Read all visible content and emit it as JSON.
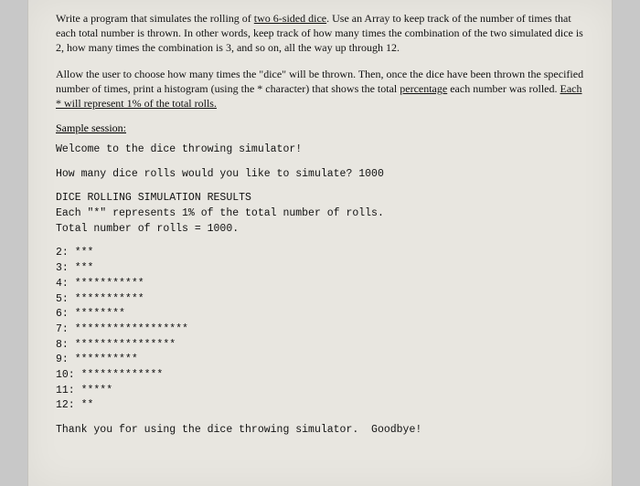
{
  "para1": {
    "pre": "Write a program that simulates the rolling of ",
    "u1": "two 6-sided dice",
    "post": ". Use an Array to keep track of the number of times that each total number is thrown. In other words, keep track of how many times the combination of the two simulated dice is 2, how many times the combination is 3, and so on, all the way up through 12."
  },
  "para2": {
    "pre": "Allow the user to choose how many times the \"dice\" will be thrown. Then, once the dice have been thrown the specified number of times, print a histogram (using the * character) that shows the total ",
    "u1": "percentage",
    "mid": " each number was rolled. ",
    "u2": "Each * will represent 1% of the total rolls."
  },
  "sample_label": "Sample session:",
  "welcome": "Welcome to the dice throwing simulator!",
  "prompt": "How many dice rolls would you like to simulate? 1000",
  "results_header": "DICE ROLLING SIMULATION RESULTS",
  "results_note": "Each \"*\" represents 1% of the total number of rolls.",
  "results_total": "Total number of rolls = 1000.",
  "histogram": [
    "2: ***",
    "3: ***",
    "4: ***********",
    "5: ***********",
    "6: ********",
    "7: ******************",
    "8: ****************",
    "9: **********",
    "10: *************",
    "11: *****",
    "12: **"
  ],
  "goodbye": "Thank you for using the dice throwing simulator.  Goodbye!"
}
